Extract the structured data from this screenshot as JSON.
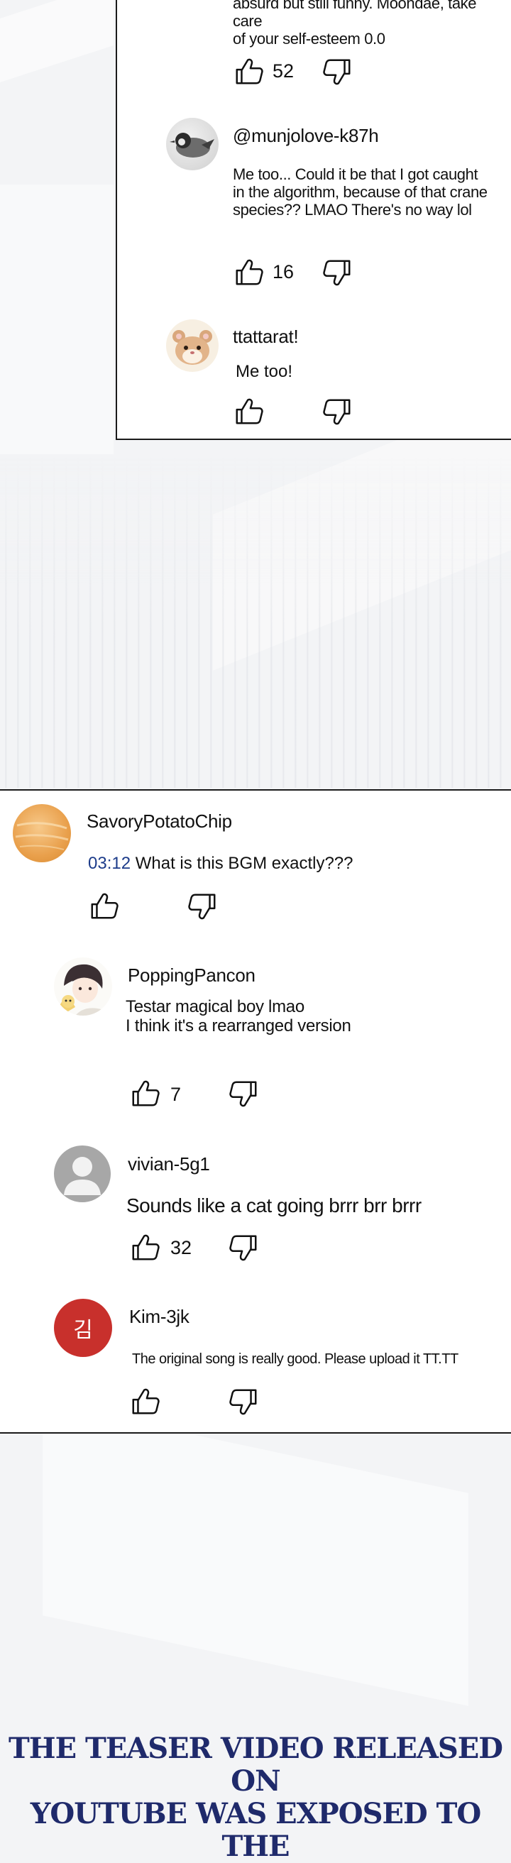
{
  "thread1": {
    "top_text_line1": "absurd but still funny. Moondae, take care",
    "top_text_line2": "of your self-esteem 0.0",
    "top_likes": "52",
    "comments": [
      {
        "username": "@munjolove-k87h",
        "lines": [
          "Me too... Could it be that I got caught",
          "in the algorithm, because of that crane",
          "species?? LMAO There's no way lol"
        ],
        "likes": "16"
      },
      {
        "username": "ttattarat!",
        "lines": [
          "Me too!"
        ],
        "likes": ""
      }
    ]
  },
  "thread2": {
    "root": {
      "username": "SavoryPotatoChip",
      "timestamp": "03:12",
      "text": " What is this BGM exactly???",
      "likes": ""
    },
    "replies": [
      {
        "username": "PoppingPancon",
        "lines": [
          "Testar magical boy lmao",
          "I think it's a rearranged version"
        ],
        "likes": "7"
      },
      {
        "username": "vivian-5g1",
        "lines": [
          "Sounds like a cat going brrr brr brrr"
        ],
        "likes": "32"
      },
      {
        "username": "Kim-3jk",
        "avatar_initial": "김",
        "lines": [
          "The original song is really good. Please upload it TT.TT"
        ],
        "likes": ""
      }
    ]
  },
  "caption": {
    "line1": "THE TEASER VIDEO RELEASED ON",
    "line2": "YOUTUBE WAS EXPOSED TO THE"
  },
  "colors": {
    "avatar_kim": "#c8302c",
    "avatar_default": "#9e9e9e",
    "caption": "#1f2a6b",
    "timestamp": "#1d3c8a"
  }
}
